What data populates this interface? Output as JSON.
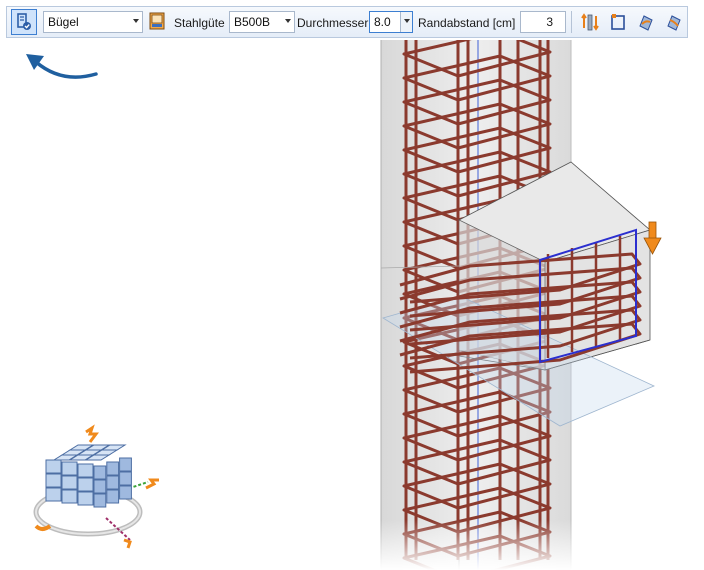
{
  "toolbar": {
    "stirrup_button_icon": "stirrup-mode-icon",
    "type_value": "Bügel",
    "grade_label": "Stahlgüte",
    "grade_value": "B500B",
    "diameter_label": "Durchmesser",
    "diameter_value": "8.0",
    "edge_label": "Randabstand [cm]",
    "edge_value": "3",
    "icons": [
      "edit-stirrup-icon",
      "flip-direction-icon",
      "rectangle-outline-icon",
      "hook-a-icon",
      "hook-b-icon"
    ]
  },
  "colors": {
    "rebar": "#8b3a2e",
    "selection": "#2b2fcf",
    "accent": "#f08a1c",
    "concrete": "#e2e2e2",
    "toolbar": "#e5edf8"
  },
  "viewport": {
    "navigation_cube_icon": "navigation-cube-icon",
    "hint_arrow_icon": "curved-arrow-icon"
  }
}
